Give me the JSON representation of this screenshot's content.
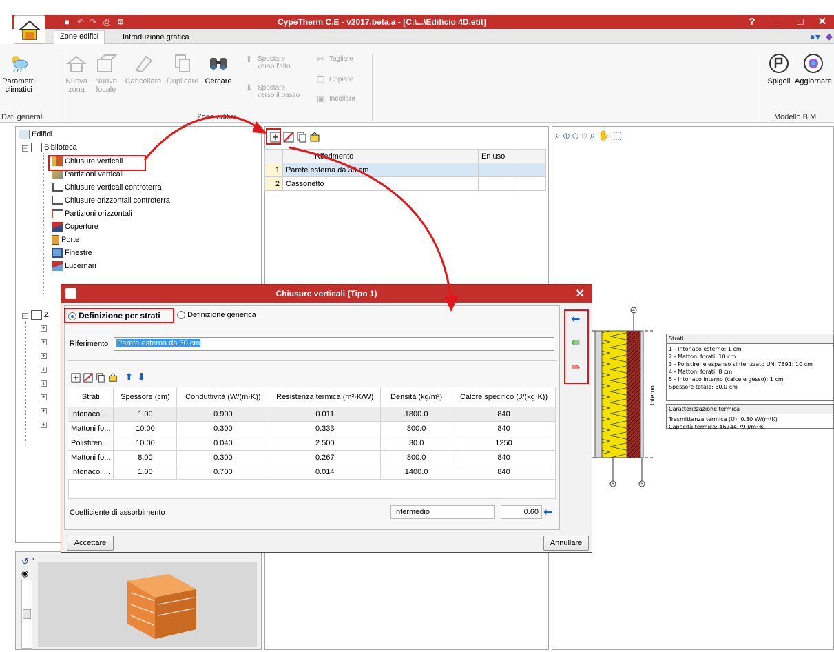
{
  "window": {
    "title": "CypeTherm C.E - v2017.beta.a - [C:\\...\\Edificio 4D.etit]",
    "help": "?",
    "minimize": "_",
    "maximize": "□",
    "close": "✕"
  },
  "ribbon": {
    "tabs": [
      "Zone edifici",
      "Introduzione grafica"
    ],
    "parametri": [
      "Parametri",
      "climatici"
    ],
    "nuova_zona": [
      "Nuova",
      "zona"
    ],
    "nuovo_locale": [
      "Nuovo",
      "locale"
    ],
    "cancellare": "Cancellare",
    "duplicare": "Duplicare",
    "cercare": "Cercare",
    "spostare_alto": [
      "Spostare",
      "verso l'alto"
    ],
    "spostare_basso": [
      "Spostare",
      "verso il basso"
    ],
    "tagliare": "Tagliare",
    "copiare": "Copiare",
    "incollare": "Incollare",
    "spigoli": "Spigoli",
    "aggiornare": "Aggiornare",
    "group_dati": "Dati generali",
    "group_zone": "Zone edifici",
    "group_bim": "Modello BIM"
  },
  "tree": {
    "root": "Edifici",
    "biblioteca": "Biblioteca",
    "items": [
      "Chiusure verticali",
      "Partizioni verticali",
      "Chiusure verticali controterra",
      "Chiusure orizzontali controterra",
      "Partizioni orizzontali",
      "Coperture",
      "Porte",
      "Finestre",
      "Lucernari"
    ],
    "zone_node": "Z"
  },
  "mid_table": {
    "headers": [
      "Riferimento",
      "En uso"
    ],
    "rows": [
      {
        "n": "1",
        "ref": "Parete esterna da 30 cm"
      },
      {
        "n": "2",
        "ref": "Cassonetto"
      }
    ]
  },
  "dialog": {
    "title": "Chiusure verticali (Tipo 1)",
    "radio_strati": "Definizione per strati",
    "radio_generica": "Definizione generica",
    "riferimento_label": "Riferimento",
    "riferimento_value": "Parete esterna da 30 cm",
    "headers": [
      "Strati",
      "Spessore (cm)",
      "Conduttività (W/(m·K))",
      "Resistenza termica (m²·K/W)",
      "Densità (kg/m³)",
      "Calore specifico (J/(kg·K))"
    ],
    "rows": [
      [
        "Intonaco ...",
        "1.00",
        "0.900",
        "0.011",
        "1800.0",
        "840"
      ],
      [
        "Mattoni fo...",
        "10.00",
        "0.300",
        "0.333",
        "800.0",
        "840"
      ],
      [
        "Polistiren...",
        "10.00",
        "0.040",
        "2.500",
        "30.0",
        "1250"
      ],
      [
        "Mattoni fo...",
        "8.00",
        "0.300",
        "0.267",
        "800.0",
        "840"
      ],
      [
        "Intonaco i...",
        "1.00",
        "0.700",
        "0.014",
        "1400.0",
        "840"
      ]
    ],
    "coeff_label": "Coefficiente di assorbimento",
    "coeff_select": "Intermedio",
    "coeff_value": "0.60",
    "accept": "Accettare",
    "cancel": "Annullare"
  },
  "section": {
    "interno": "Interno",
    "markers": [
      "4",
      "5",
      "5"
    ],
    "legend_strati_title": "Strati",
    "legend_strati": [
      "1 - Intonaco esterno: 1 cm",
      "2 - Mattoni forati: 10 cm",
      "3 - Polistirene espanso sinterizzato UNI 7891: 10 cm",
      "4 - Mattoni forati: 8 cm",
      "5 - Intonaco interno (calce e gesso): 1 cm",
      "Spessore totale: 30.0 cm"
    ],
    "legend_term_title": "Caratterizzazione termica",
    "legend_term": [
      "Trasmittanza termica (U): 0.30 W/(m²K)",
      "Capacità termica: 46744.79 J/m²·K"
    ]
  },
  "colors": {
    "title_red": "#c3302b",
    "highlight": "#e0171b",
    "insulation": "#f2e200",
    "brick": "#9a2a22",
    "plaster": "#d8d8d8"
  }
}
